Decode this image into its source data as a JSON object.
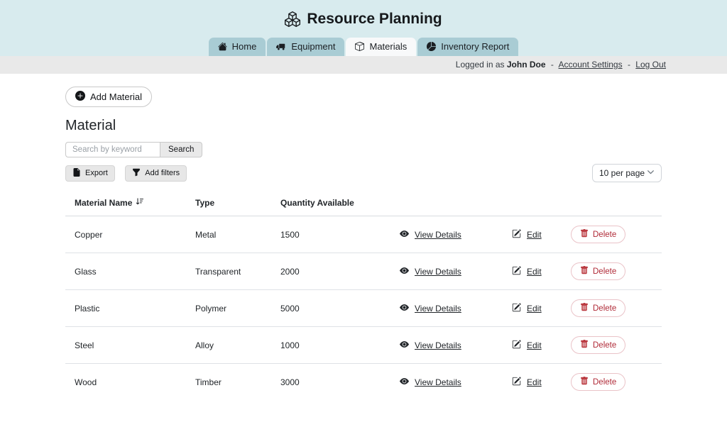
{
  "header": {
    "title": "Resource Planning",
    "tabs": [
      {
        "label": "Home",
        "icon": "house-icon",
        "active": false
      },
      {
        "label": "Equipment",
        "icon": "truck-icon",
        "active": false
      },
      {
        "label": "Materials",
        "icon": "box-icon",
        "active": true
      },
      {
        "label": "Inventory Report",
        "icon": "pie-chart-icon",
        "active": false
      }
    ],
    "app_icon": "boxes-icon"
  },
  "account_bar": {
    "logged_in_prefix": "Logged in as",
    "user_name": "John Doe",
    "sep1": "-",
    "account_settings_label": "Account Settings",
    "sep2": "-",
    "log_out_label": "Log Out"
  },
  "content": {
    "add_material_label": "Add Material",
    "heading": "Material",
    "search": {
      "placeholder": "Search by keyword",
      "button_label": "Search"
    },
    "toolbar": {
      "export_label": "Export",
      "add_filters_label": "Add filters",
      "per_page_value": "10 per page"
    }
  },
  "table": {
    "headers": {
      "name": "Material Name",
      "type": "Type",
      "qty": "Quantity Available"
    },
    "sort_icon": "sort-ascending-icon",
    "action_labels": {
      "view": "View Details",
      "edit": "Edit",
      "delete": "Delete"
    },
    "rows": [
      {
        "name": "Copper",
        "type": "Metal",
        "qty": "1500"
      },
      {
        "name": "Glass",
        "type": "Transparent",
        "qty": "2000"
      },
      {
        "name": "Plastic",
        "type": "Polymer",
        "qty": "5000"
      },
      {
        "name": "Steel",
        "type": "Alloy",
        "qty": "1000"
      },
      {
        "name": "Wood",
        "type": "Timber",
        "qty": "3000"
      }
    ]
  },
  "colors": {
    "banner_bg": "#d8ebee",
    "tab_bg": "#a9ccd4",
    "tab_active_bg": "#f8f9fa",
    "account_bar_bg": "#e9e9e9",
    "delete_text": "#b02a37",
    "delete_border": "#eac3c8",
    "delete_icon": "#bb3a41"
  }
}
